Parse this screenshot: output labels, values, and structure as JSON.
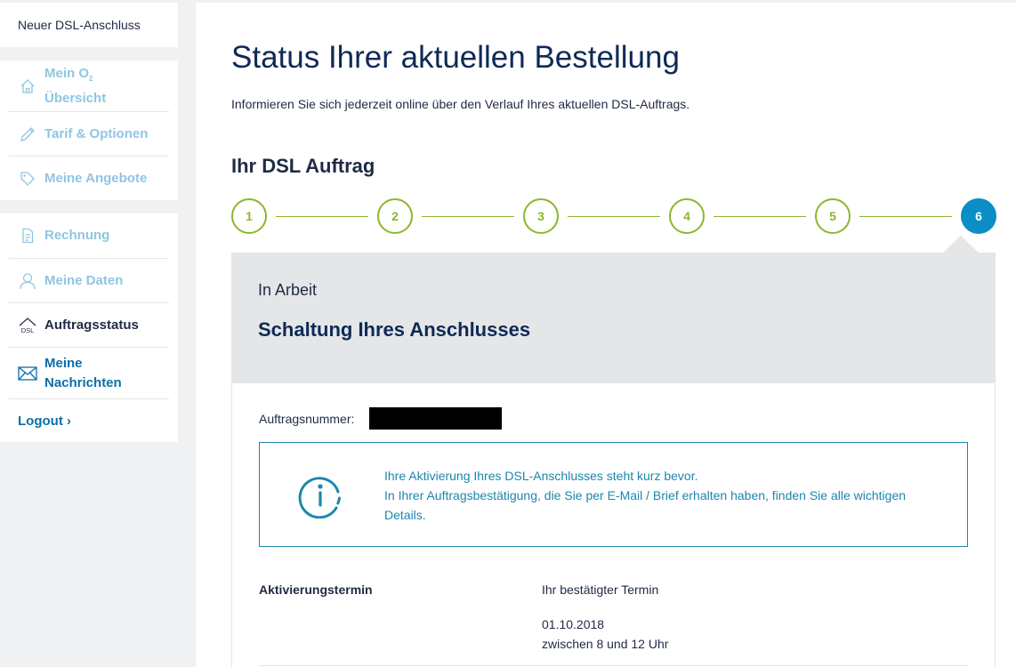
{
  "sidebar": {
    "top_link": "Neuer DSL-Anschluss",
    "group1": [
      {
        "label_line1": "Mein O",
        "label_sub": "2",
        "label_line2": "Übersicht",
        "icon": "home-icon"
      },
      {
        "label": "Tarif & Optionen",
        "icon": "pencil-icon"
      },
      {
        "label": "Meine Angebote",
        "icon": "tag-icon"
      }
    ],
    "group2": [
      {
        "label": "Rechnung",
        "icon": "document-icon"
      },
      {
        "label": "Meine Daten",
        "icon": "user-icon"
      },
      {
        "label": "Auftragsstatus",
        "icon": "dsl-house-icon",
        "icon_text": "DSL"
      },
      {
        "label_line1": "Meine",
        "label_line2": "Nachrichten",
        "icon": "envelope-icon"
      }
    ],
    "logout": "Logout ›"
  },
  "main": {
    "title": "Status Ihrer aktuellen Bestellung",
    "subtitle": "Informieren Sie sich jederzeit online über den Verlauf Ihres aktuellen DSL-Auftrags.",
    "section_title": "Ihr DSL Auftrag",
    "steps": [
      "1",
      "2",
      "3",
      "4",
      "5",
      "6"
    ],
    "current_step": 6,
    "status": {
      "label": "In Arbeit",
      "title": "Schaltung Ihres Anschlusses"
    },
    "order_number_label": "Auftragsnummer:",
    "info": {
      "line1": "Ihre Aktivierung Ihres DSL-Anschlusses steht kurz bevor.",
      "line2": "In Ihrer Auftragsbestätigung, die Sie per E-Mail / Brief erhalten haben, finden Sie alle wichtigen Details."
    },
    "activation": {
      "label": "Aktivierungstermin",
      "confirmed": "Ihr bestätigter Termin",
      "date": "01.10.2018",
      "time": "zwischen 8 und 12 Uhr"
    }
  },
  "colors": {
    "green": "#8db62e",
    "blue": "#0b8ec5",
    "navy": "#0e2a55",
    "info_blue": "#1c86ae",
    "light_blue_label": "#8fc6e3"
  }
}
